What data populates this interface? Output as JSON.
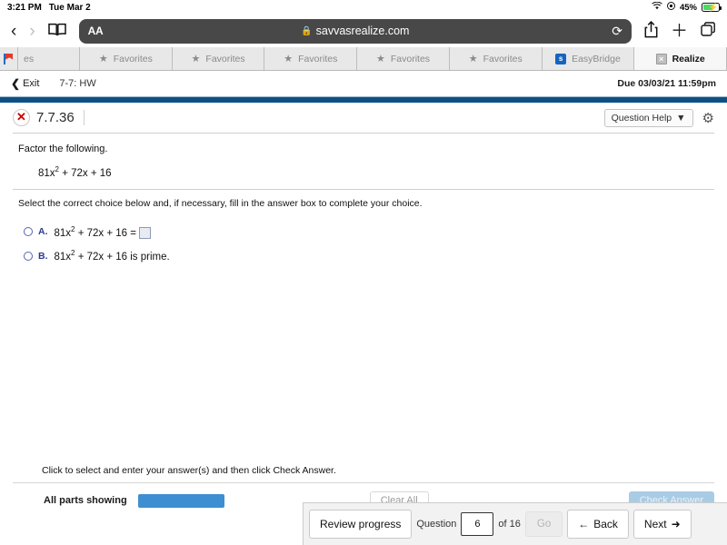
{
  "status_bar": {
    "time": "3:21 PM",
    "date": "Tue Mar 2",
    "wifi_icon": "wifi-icon",
    "location_icon": "location-icon",
    "battery_percent": "45%"
  },
  "browser": {
    "back_icon": "back-chevron-icon",
    "forward_icon": "forward-chevron-icon",
    "bookmarks_icon": "book-icon",
    "text_size_label": "AA",
    "lock_icon": "lock-icon",
    "url": "savvasrealize.com",
    "reload_icon": "reload-icon",
    "share_icon": "share-icon",
    "new_tab_icon": "plus-icon",
    "tabs_icon": "tabs-icon"
  },
  "tabs": [
    {
      "label": "",
      "icon": "flag-favicon",
      "active": false
    },
    {
      "label": "es",
      "icon": "",
      "active": false
    },
    {
      "label": "Favorites",
      "icon": "star-icon",
      "active": false
    },
    {
      "label": "Favorites",
      "icon": "star-icon",
      "active": false
    },
    {
      "label": "Favorites",
      "icon": "star-icon",
      "active": false
    },
    {
      "label": "Favorites",
      "icon": "star-icon",
      "active": false
    },
    {
      "label": "Favorites",
      "icon": "star-icon",
      "active": false
    },
    {
      "label": "EasyBridge",
      "icon": "easybridge-favicon",
      "active": false
    },
    {
      "label": "Realize",
      "icon": "close-icon",
      "active": true
    }
  ],
  "app_header": {
    "exit_label": "Exit",
    "exit_icon": "back-chevron-icon",
    "assignment": "7-7: HW",
    "due": "Due 03/03/21 11:59pm"
  },
  "question": {
    "status_icon": "error-x-icon",
    "number": "7.7.36",
    "help_label": "Question Help",
    "help_caret": "▼",
    "settings_icon": "gear-icon",
    "prompt": "Factor the following.",
    "expression_base": "81x",
    "expression_exp": "2",
    "expression_rest": " + 72x + 16",
    "instruction": "Select the correct choice below and, if necessary, fill in the answer box to complete your choice.",
    "choices": [
      {
        "letter": "A.",
        "text_base": "81x",
        "text_exp": "2",
        "text_rest": " + 72x + 16 =",
        "has_answer_box": true,
        "selected": false
      },
      {
        "letter": "B.",
        "text_base": "81x",
        "text_exp": "2",
        "text_rest": " + 72x + 16 is prime.",
        "has_answer_box": false,
        "selected": false
      }
    ]
  },
  "footer": {
    "hint": "Click to select and enter your answer(s) and then click Check Answer.",
    "all_parts_label": "All parts showing",
    "clear_all_label": "Clear All",
    "check_answer_label": "Check Answer"
  },
  "bottom_nav": {
    "review_progress_label": "Review progress",
    "question_label": "Question",
    "question_value": "6",
    "of_label": "of 16",
    "go_label": "Go",
    "back_label": "Back",
    "back_icon": "left-arrow-icon",
    "next_label": "Next",
    "next_icon": "right-arrow-icon"
  },
  "colors": {
    "brand_blue": "#0d5184",
    "accent_blue": "#3d8fd1",
    "error_red": "#cc0000",
    "disabled_blue": "#a9cce5"
  }
}
